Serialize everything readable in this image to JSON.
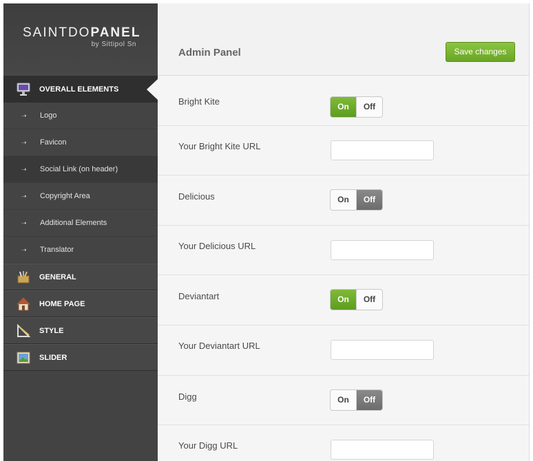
{
  "brand": {
    "title_light": "SAINTDO",
    "title_bold": "PANEL",
    "subtitle": "by Sittipol Sn"
  },
  "sidebar": {
    "active_section": {
      "label": "OVERALL ELEMENTS",
      "icon": "monitor-icon"
    },
    "sub_items": [
      {
        "label": "Logo",
        "icon": "arrow-right-icon"
      },
      {
        "label": "Favicon",
        "icon": "arrow-right-icon"
      },
      {
        "label": "Social Link (on header)",
        "icon": "arrow-right-icon"
      },
      {
        "label": "Copyright Area",
        "icon": "arrow-right-icon"
      },
      {
        "label": "Additional Elements",
        "icon": "arrow-right-icon"
      },
      {
        "label": "Translator",
        "icon": "arrow-right-icon"
      }
    ],
    "sections": [
      {
        "label": "GENERAL",
        "icon": "toolbox-icon"
      },
      {
        "label": "HOME PAGE",
        "icon": "house-icon"
      },
      {
        "label": "STYLE",
        "icon": "ruler-pencil-icon"
      },
      {
        "label": "SLIDER",
        "icon": "picture-icon"
      }
    ]
  },
  "header": {
    "title": "Admin Panel",
    "save_label": "Save changes"
  },
  "rows": [
    {
      "type": "toggle",
      "label": "Bright Kite",
      "on_label": "On",
      "off_label": "Off",
      "state": "on"
    },
    {
      "type": "input",
      "label": "Your Bright Kite URL",
      "value": ""
    },
    {
      "type": "toggle",
      "label": "Delicious",
      "on_label": "On",
      "off_label": "Off",
      "state": "off"
    },
    {
      "type": "input",
      "label": "Your Delicious URL",
      "value": ""
    },
    {
      "type": "toggle",
      "label": "Deviantart",
      "on_label": "On",
      "off_label": "Off",
      "state": "on"
    },
    {
      "type": "input",
      "label": "Your Deviantart URL",
      "value": ""
    },
    {
      "type": "toggle",
      "label": "Digg",
      "on_label": "On",
      "off_label": "Off",
      "state": "off"
    },
    {
      "type": "input",
      "label": "Your Digg URL",
      "value": ""
    }
  ],
  "colors": {
    "accent_green": "#6aa526",
    "sidebar_bg": "#434343"
  }
}
